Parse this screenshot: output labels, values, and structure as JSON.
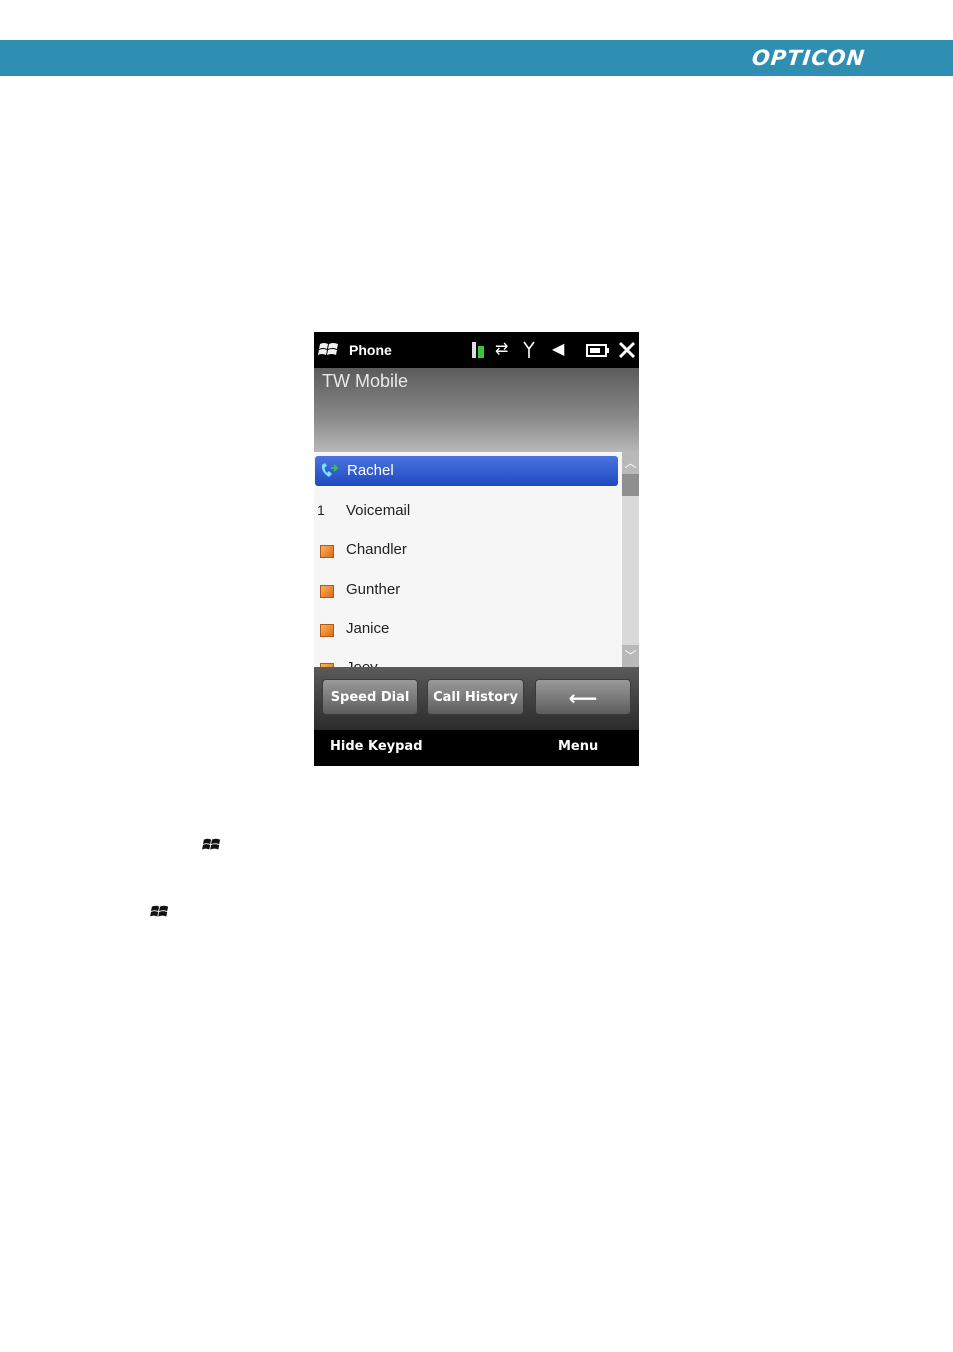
{
  "header": {
    "brand": "OPTICON",
    "bar_color": "#2f8fb3"
  },
  "phone": {
    "title": "Phone",
    "carrier": "TW Mobile",
    "contacts": [
      {
        "lead": "",
        "label": "Rachel",
        "selected": true,
        "icon": "phone-call-icon"
      },
      {
        "lead": "1",
        "label": "Voicemail",
        "selected": false
      },
      {
        "lead": "",
        "label": "Chandler",
        "selected": false,
        "icon": "contact-card-icon"
      },
      {
        "lead": "",
        "label": "Gunther",
        "selected": false,
        "icon": "contact-card-icon"
      },
      {
        "lead": "",
        "label": "Janice",
        "selected": false,
        "icon": "contact-card-icon"
      },
      {
        "lead": "",
        "label": "Joey",
        "selected": false,
        "icon": "contact-card-icon"
      }
    ],
    "buttons": {
      "speed_dial": "Speed Dial",
      "call_history": "Call History",
      "backspace": "⟵"
    },
    "softkeys": {
      "left": "Hide Keypad",
      "right": "Menu"
    },
    "status_icons": [
      "battery-charging-icon",
      "data-sync-icon",
      "signal-icon",
      "speaker-icon",
      "battery-icon",
      "close-icon"
    ]
  }
}
